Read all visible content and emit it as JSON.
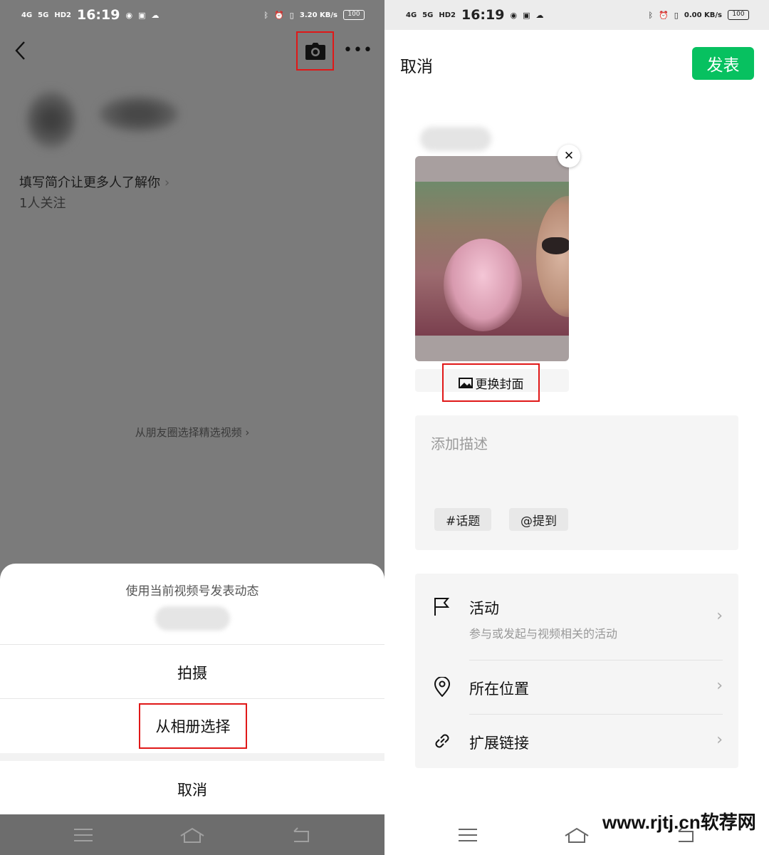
{
  "left_status": {
    "net1": "4G",
    "net2": "5G",
    "hd": "HD2",
    "time": "16:19",
    "speed": "3.20 KB/s",
    "battery": "100"
  },
  "right_status": {
    "net1": "4G",
    "net2": "5G",
    "hd": "HD2",
    "time": "16:19",
    "speed": "0.00 KB/s",
    "battery": "100"
  },
  "profile": {
    "bio_prompt": "填写简介让更多人了解你",
    "followers": "1人关注",
    "moments_link": "从朋友圈选择精选视频"
  },
  "action_sheet": {
    "title": "使用当前视频号发表动态",
    "shoot": "拍摄",
    "album": "从相册选择",
    "cancel": "取消"
  },
  "composer": {
    "cancel": "取消",
    "publish": "发表",
    "change_cover": "更换封面",
    "description_placeholder": "添加描述",
    "topic_chip": "#话题",
    "mention_chip": "@提到",
    "options": [
      {
        "title": "活动",
        "subtitle": "参与或发起与视频相关的活动",
        "icon": "flag-icon"
      },
      {
        "title": "所在位置",
        "icon": "location-pin-icon"
      },
      {
        "title": "扩展链接",
        "icon": "link-icon"
      }
    ]
  },
  "watermark": "www.rjtj.cn软荐网",
  "colors": {
    "accent_green": "#07c160",
    "highlight_red": "#e01818",
    "dim_overlay": "#7b7b7b"
  }
}
